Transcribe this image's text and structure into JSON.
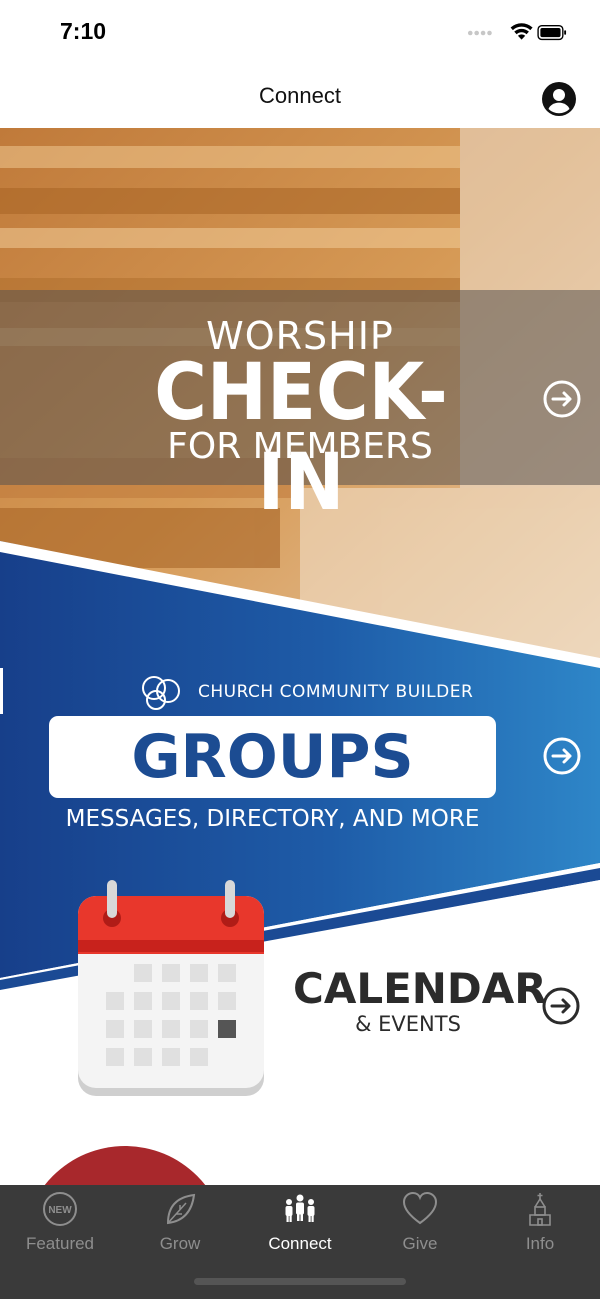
{
  "status_bar": {
    "time": "7:10"
  },
  "nav": {
    "title": "Connect"
  },
  "worship_banner": {
    "line1": "WORSHIP",
    "line2": "CHECK-IN",
    "line3": "FOR MEMBERS"
  },
  "groups_banner": {
    "brand": "CHURCH COMMUNITY BUILDER",
    "title": "GROUPS",
    "subtitle": "MESSAGES, DIRECTORY, AND MORE"
  },
  "calendar_banner": {
    "title": "CALENDAR",
    "subtitle": "& EVENTS"
  },
  "tabs": [
    {
      "label": "Featured",
      "icon": "new-badge-icon",
      "active": false,
      "badge": "NEW"
    },
    {
      "label": "Grow",
      "icon": "leaf-icon",
      "active": false
    },
    {
      "label": "Connect",
      "icon": "people-icon",
      "active": true
    },
    {
      "label": "Give",
      "icon": "heart-icon",
      "active": false
    },
    {
      "label": "Info",
      "icon": "church-icon",
      "active": false
    }
  ],
  "colors": {
    "tab_bar": "#3a3a3a",
    "groups_blue": "#1c4c92",
    "calendar_red": "#e8372c"
  }
}
